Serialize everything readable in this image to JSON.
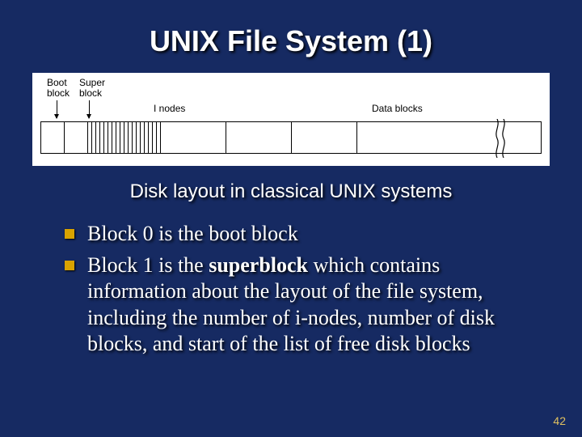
{
  "title": "UNIX File System (1)",
  "diagram": {
    "boot_label": "Boot\nblock",
    "super_label": "Super\nblock",
    "inodes_label": "I nodes",
    "data_label": "Data blocks"
  },
  "subtitle": "Disk layout in classical UNIX systems",
  "bullets": [
    {
      "pre": "Block 0 is the boot block",
      "bold": "",
      "post": ""
    },
    {
      "pre": "Block 1 is the ",
      "bold": "superblock",
      "post": " which contains information about the layout of the file system, including the number of i-nodes, number of disk blocks, and start of the list of free disk blocks"
    }
  ],
  "page": "42"
}
